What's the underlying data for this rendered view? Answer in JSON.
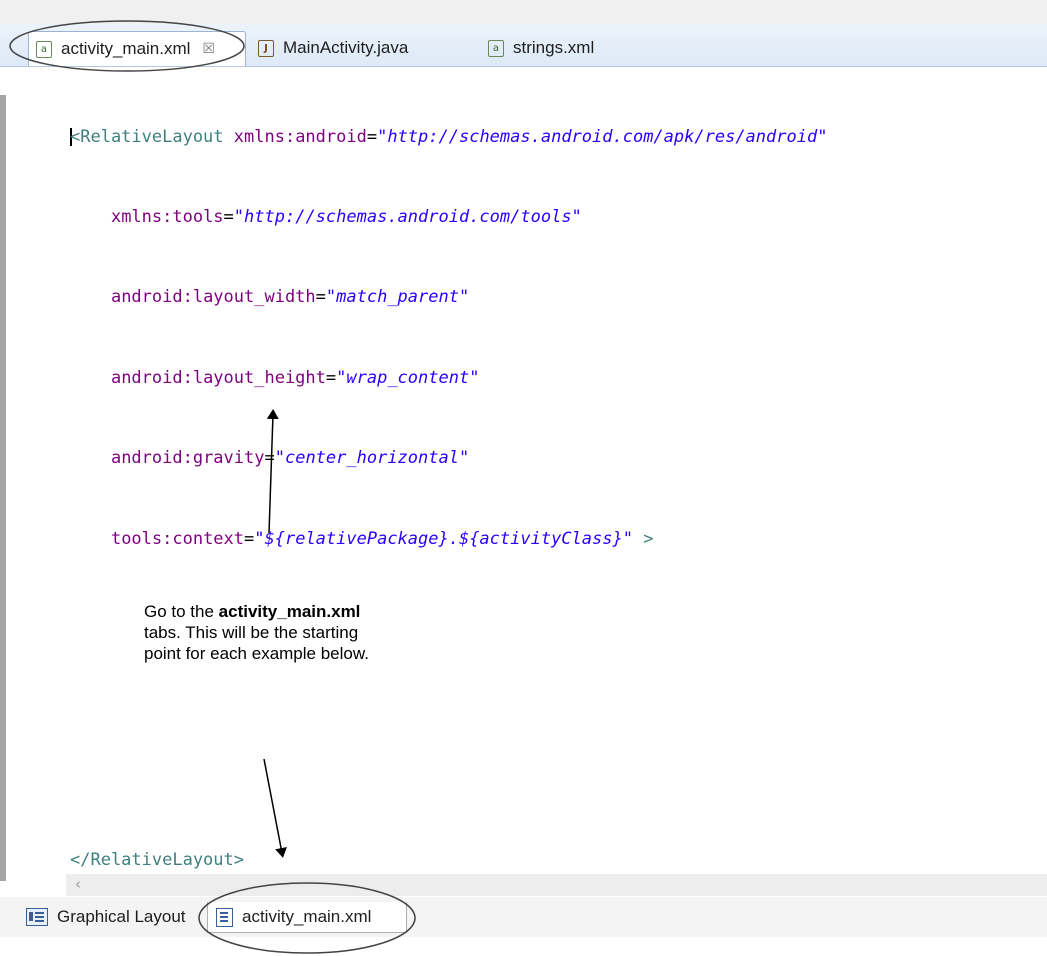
{
  "tabs": [
    {
      "label": "activity_main.xml",
      "icon": "xml-file-icon",
      "active": true
    },
    {
      "label": "MainActivity.java",
      "icon": "java-file-icon",
      "active": false
    },
    {
      "label": "strings.xml",
      "icon": "xml-file-icon",
      "active": false
    }
  ],
  "editor": {
    "open_tag": "<RelativeLayout",
    "line1_attr": "xmlns:android",
    "line1_val": "\"http://schemas.android.com/apk/res/android\"",
    "line2_attr": "xmlns:tools",
    "line2_val": "\"http://schemas.android.com/tools\"",
    "line3_attr": "android:layout_width",
    "line3_val": "\"match_parent\"",
    "line4_attr": "android:layout_height",
    "line4_val": "\"wrap_content\"",
    "line5_attr": "android:gravity",
    "line5_val": "\"center_horizontal\"",
    "line6_attr": "tools:context",
    "line6_val": "\"${relativePackage}.${activityClass}\"",
    "gt": " >",
    "eq": "=",
    "close_tag": "</RelativeLayout>"
  },
  "annotation": {
    "bold": "activity_main.xml",
    "pre": "Go to the ",
    "line2": "tabs. This will be the starting",
    "line3": "point for each example below."
  },
  "bottom_tabs": [
    {
      "label": "Graphical Layout",
      "icon": "layout-icon",
      "active": false
    },
    {
      "label": "activity_main.xml",
      "icon": "xml-source-icon",
      "active": true
    }
  ],
  "colors": {
    "tag": "#3f7f7f",
    "attribute": "#7f007f",
    "value": "#2a00ff",
    "annotation_ink": "#444444"
  }
}
